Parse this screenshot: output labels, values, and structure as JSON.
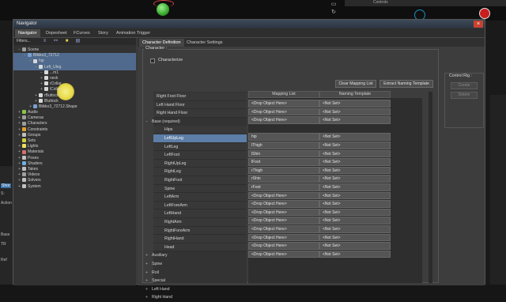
{
  "window": {
    "title": "Navigator"
  },
  "main_tabs": [
    "Navigator",
    "Dopesheet",
    "FCurves",
    "Story",
    "Animation Trigger"
  ],
  "background": {
    "topright_tabs": [
      "",
      "Controls"
    ],
    "left_strip": [
      "Shor",
      "S:",
      "Action",
      "Base",
      "TR",
      "Ref"
    ]
  },
  "tree": {
    "filters_label": "Filters...",
    "rows": [
      {
        "label": "Scene",
        "indent": 0,
        "expander": "−",
        "color": "#9c9c9c",
        "sel": false
      },
      {
        "label": "Blikko3_72712",
        "indent": 1,
        "expander": "−",
        "color": "#7aa0d0",
        "sel": true
      },
      {
        "label": "hip",
        "indent": 2,
        "expander": "−",
        "color": "#d8d8d8",
        "sel": true
      },
      {
        "label": "Left_Uleg",
        "indent": 3,
        "expander": "−",
        "color": "#d8d8d8",
        "sel": true
      },
      {
        "label": "...m1",
        "indent": 4,
        "expander": "−",
        "color": "#d8d8d8",
        "sel": false
      },
      {
        "label": "neck",
        "indent": 4,
        "expander": "+",
        "color": "#d8d8d8",
        "sel": false
      },
      {
        "label": "rCollar",
        "indent": 4,
        "expander": "+",
        "color": "#d8d8d8",
        "sel": false
      },
      {
        "label": "lCollar",
        "indent": 4,
        "expander": "+",
        "color": "#d8d8d8",
        "sel": false
      },
      {
        "label": "rButtock",
        "indent": 3,
        "expander": "+",
        "color": "#d8d8d8",
        "sel": false
      },
      {
        "label": "lButtock",
        "indent": 3,
        "expander": "+",
        "color": "#d8d8d8",
        "sel": false
      },
      {
        "label": "Blikko3_72712.Shape",
        "indent": 2,
        "expander": "+",
        "color": "#7aa0d0",
        "sel": false
      },
      {
        "label": "Audio",
        "indent": 0,
        "expander": "+",
        "color": "#8bc34a",
        "sel": false
      },
      {
        "label": "Cameras",
        "indent": 0,
        "expander": "+",
        "color": "#9e9e9e",
        "sel": false
      },
      {
        "label": "Characters",
        "indent": 0,
        "expander": "+",
        "color": "#9e9e9e",
        "sel": false
      },
      {
        "label": "Constraints",
        "indent": 0,
        "expander": "+",
        "color": "#e0a030",
        "sel": false
      },
      {
        "label": "Groups",
        "indent": 0,
        "expander": "+",
        "color": "#c0c0c0",
        "sel": false
      },
      {
        "label": "Sets",
        "indent": 0,
        "expander": "",
        "color": "#d0d040",
        "sel": false
      },
      {
        "label": "Lights",
        "indent": 0,
        "expander": "+",
        "color": "#f0e060",
        "sel": false
      },
      {
        "label": "Materials",
        "indent": 0,
        "expander": "+",
        "color": "#d07070",
        "sel": false
      },
      {
        "label": "Poses",
        "indent": 0,
        "expander": "+",
        "color": "#c0c0c0",
        "sel": false
      },
      {
        "label": "Shaders",
        "indent": 0,
        "expander": "+",
        "color": "#70b0e0",
        "sel": false
      },
      {
        "label": "Takes",
        "indent": 0,
        "expander": "+",
        "color": "#c0c0c0",
        "sel": false
      },
      {
        "label": "Videos",
        "indent": 0,
        "expander": "+",
        "color": "#a0a0a0",
        "sel": false
      },
      {
        "label": "Solvers",
        "indent": 0,
        "expander": "+",
        "color": "#c0c0c0",
        "sel": false
      },
      {
        "label": "System",
        "indent": 0,
        "expander": "+",
        "color": "#c0c0c0",
        "sel": false
      }
    ]
  },
  "char": {
    "tabs": [
      "Character Definition",
      "Character Settings"
    ],
    "group_label": "Character :",
    "characterize_label": "Characterize",
    "clear_button": "Clear Mapping List",
    "extract_button": "Extract Naming Template",
    "mapping_header": "Mapping List",
    "template_header": "Naming Template",
    "rows": [
      {
        "kind": "bone",
        "label": "Right Foot Floor",
        "map": "<Drop Object Here>",
        "tpl": "<Not Set>"
      },
      {
        "kind": "bone",
        "label": "Left Hand Floor",
        "map": "<Drop Object Here>",
        "tpl": "<Not Set>"
      },
      {
        "kind": "bone",
        "label": "Right Hand Floor",
        "map": "<Drop Object Here>",
        "tpl": "<Not Set>"
      },
      {
        "kind": "group",
        "label": "Base (required)",
        "expander": "−"
      },
      {
        "kind": "bone",
        "label": "Hips",
        "map": "hip",
        "tpl": "<Not Set>"
      },
      {
        "kind": "bone",
        "label": "LeftUpLeg",
        "map": "lThigh",
        "tpl": "<Not Set>",
        "sel": true
      },
      {
        "kind": "bone",
        "label": "LeftLeg",
        "map": "lShin",
        "tpl": "<Not Set>"
      },
      {
        "kind": "bone",
        "label": "LeftFoot",
        "map": "lFoot",
        "tpl": "<Not Set>"
      },
      {
        "kind": "bone",
        "label": "RightUpLeg",
        "map": "rThigh",
        "tpl": "<Not Set>"
      },
      {
        "kind": "bone",
        "label": "RightLeg",
        "map": "rShin",
        "tpl": "<Not Set>"
      },
      {
        "kind": "bone",
        "label": "RightFoot",
        "map": "rFoot",
        "tpl": "<Not Set>"
      },
      {
        "kind": "bone",
        "label": "Spine",
        "map": "<Drop Object Here>",
        "tpl": "<Not Set>"
      },
      {
        "kind": "bone",
        "label": "LeftArm",
        "map": "<Drop Object Here>",
        "tpl": "<Not Set>"
      },
      {
        "kind": "bone",
        "label": "LeftForeArm",
        "map": "<Drop Object Here>",
        "tpl": "<Not Set>"
      },
      {
        "kind": "bone",
        "label": "LeftHand",
        "map": "<Drop Object Here>",
        "tpl": "<Not Set>"
      },
      {
        "kind": "bone",
        "label": "RightArm",
        "map": "<Drop Object Here>",
        "tpl": "<Not Set>"
      },
      {
        "kind": "bone",
        "label": "RightForeArm",
        "map": "<Drop Object Here>",
        "tpl": "<Not Set>"
      },
      {
        "kind": "bone",
        "label": "RightHand",
        "map": "<Drop Object Here>",
        "tpl": "<Not Set>"
      },
      {
        "kind": "bone",
        "label": "Head",
        "map": "<Drop Object Here>",
        "tpl": "<Not Set>"
      },
      {
        "kind": "group",
        "label": "Auxiliary",
        "expander": "+"
      },
      {
        "kind": "group",
        "label": "Spine",
        "expander": "+"
      },
      {
        "kind": "group",
        "label": "Roll",
        "expander": "+"
      },
      {
        "kind": "group",
        "label": "Special",
        "expander": "+"
      },
      {
        "kind": "group",
        "label": "Left Hand",
        "expander": "+"
      },
      {
        "kind": "group",
        "label": "Right Hand",
        "expander": "+"
      }
    ]
  },
  "control_rig": {
    "label": "Control Rig :",
    "create": "Create",
    "delete": "Delete"
  }
}
